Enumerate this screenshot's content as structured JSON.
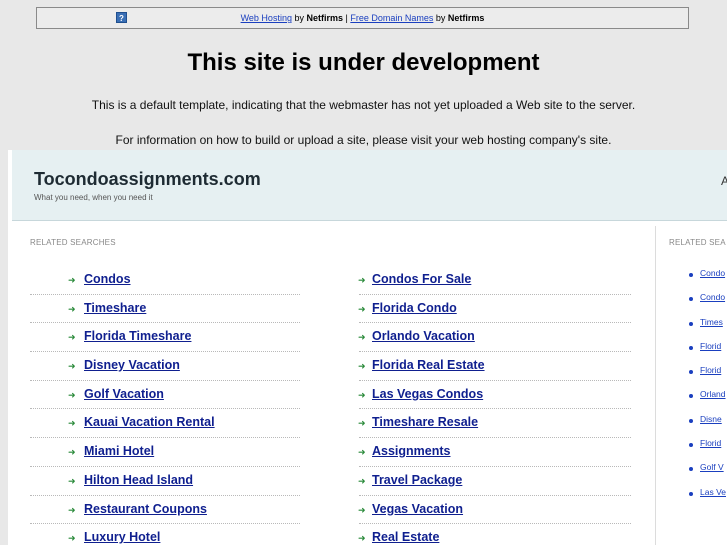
{
  "topbar": {
    "link1": "Web Hosting",
    "by1": " by ",
    "brand1": "Netfirms",
    "sep": " | ",
    "link2": "Free Domain Names",
    "by2": " by ",
    "brand2": "Netfirms",
    "icon": "question-icon"
  },
  "heading": "This site is under development",
  "message1": "This is a default template, indicating that the webmaster has not yet uploaded a Web site to the server.",
  "message2": "For information on how to build or upload a site, please visit your web hosting company's site.",
  "site": {
    "title": "Tocondoassignments.com",
    "tagline": "What you need, when you need it",
    "header_right": "A"
  },
  "related_label": "RELATED SEARCHES",
  "related_label_right": "RELATED SEA",
  "left_column": [
    "Condos",
    "Timeshare",
    "Florida Timeshare",
    "Disney Vacation",
    "Golf Vacation",
    "Kauai Vacation Rental",
    "Miami Hotel",
    "Hilton Head Island",
    "Restaurant Coupons",
    "Luxury Hotel"
  ],
  "middle_column": [
    "Condos For Sale",
    "Florida Condo",
    "Orlando Vacation",
    "Florida Real Estate",
    "Las Vegas Condos",
    "Timeshare Resale",
    "Assignments",
    "Travel Package",
    "Vegas Vacation",
    "Real Estate"
  ],
  "right_column": [
    "Condo",
    "Condo",
    "Times",
    "Florid",
    "Florid",
    "Orland",
    "Disne",
    "Florid",
    "Golf V",
    "Las Ve"
  ],
  "colors": {
    "link": "#0f1f8f",
    "arrow": "#2a8a3a",
    "header_bg": "#e6f0f2",
    "page_bg": "#e8e8e8"
  }
}
